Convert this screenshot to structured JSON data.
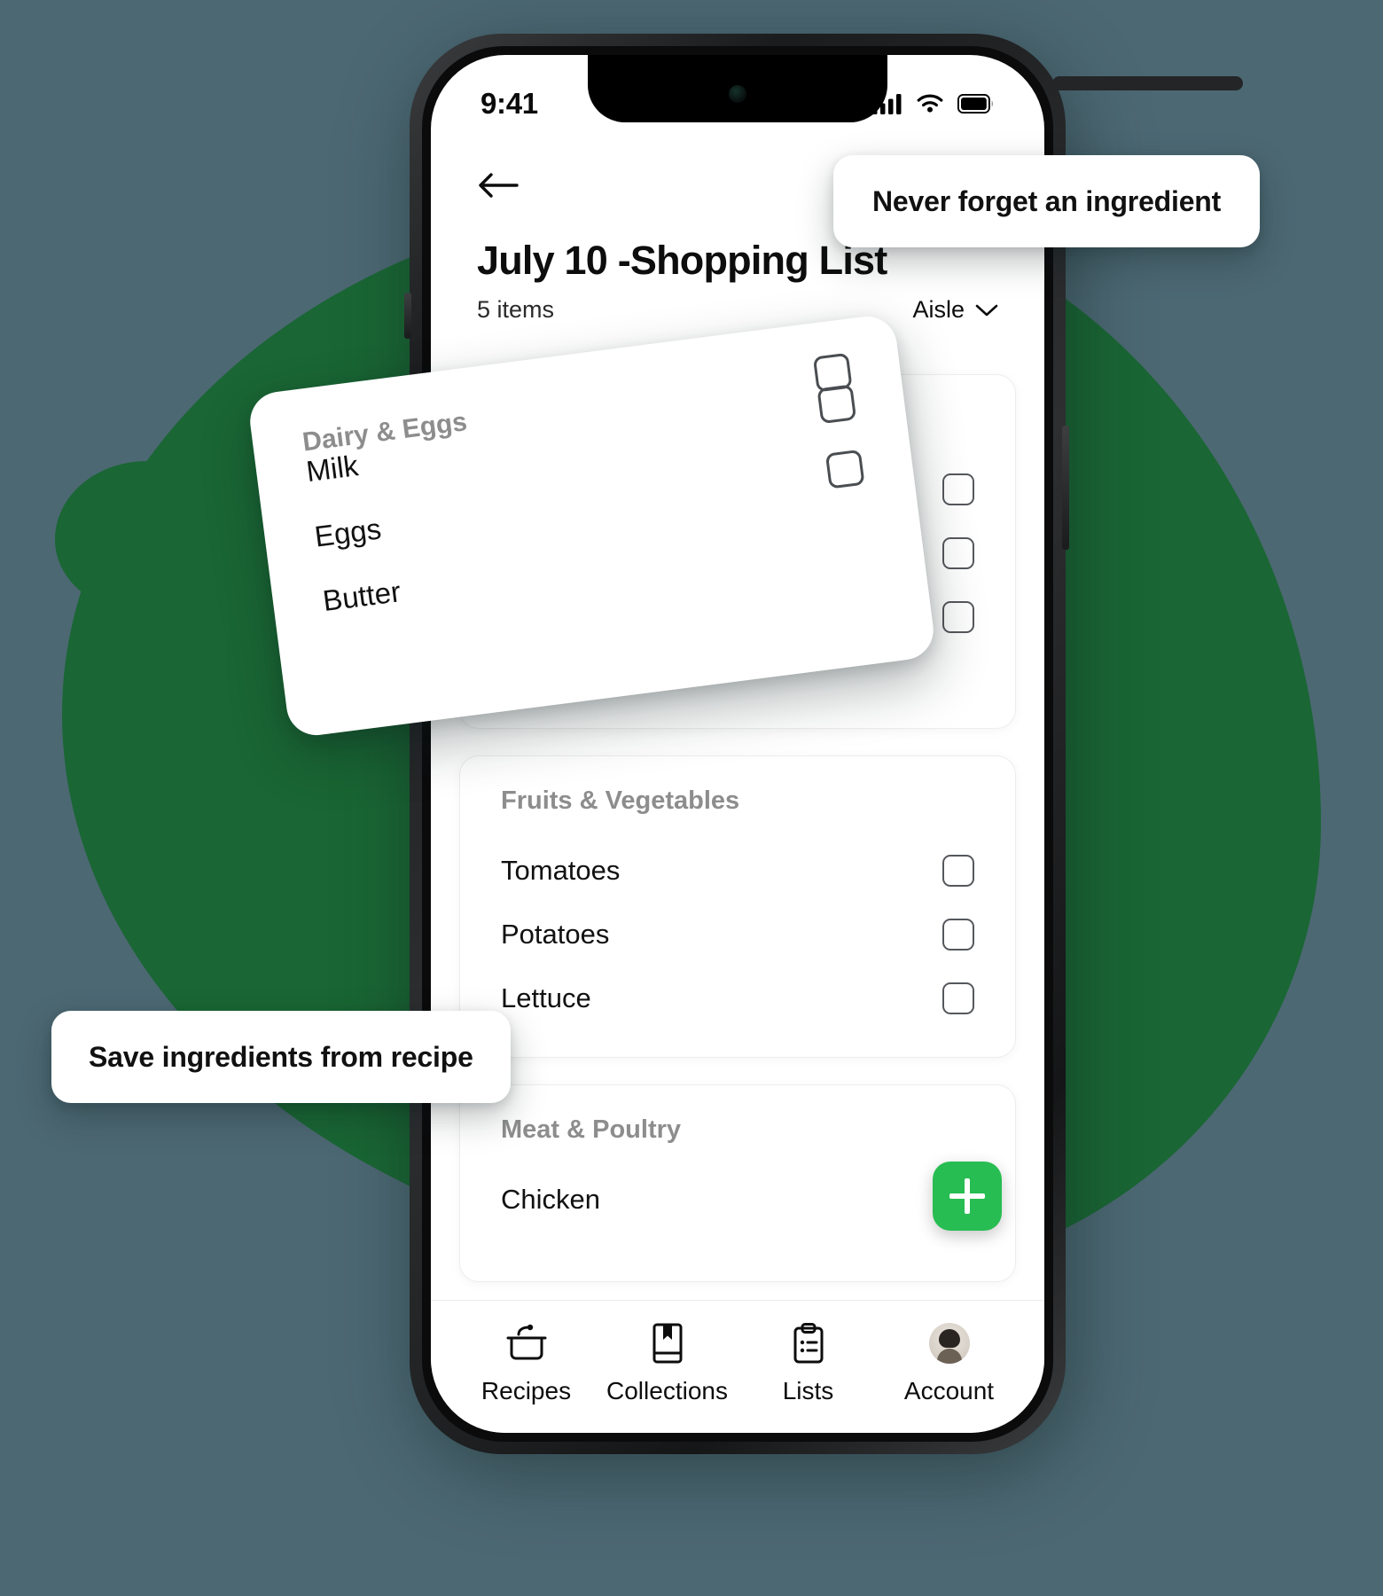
{
  "theme": {
    "background": "#4c6873",
    "blob_green": "#1a6634",
    "accent_green": "#27bd52",
    "card_white": "#ffffff",
    "muted_text": "#8d8d8d"
  },
  "callouts": [
    {
      "id": "never-forget",
      "text": "Never forget an ingredient"
    },
    {
      "id": "save-ingredients",
      "text": "Save ingredients from recipe"
    }
  ],
  "phone": {
    "status_bar": {
      "time": "9:41",
      "icons": [
        "signal-icon",
        "wifi-icon",
        "battery-icon"
      ]
    },
    "appbar": {
      "back_icon": "back-arrow-icon"
    },
    "header": {
      "title": "July 10 -Shopping List",
      "items_count": "5 items",
      "sort_label": "Aisle",
      "sort_icon": "chevron-down-icon"
    },
    "sections": [
      {
        "heading": "Dairy & Eggs",
        "items": [
          {
            "label": "Milk",
            "checked": false
          },
          {
            "label": "Eggs",
            "checked": false
          },
          {
            "label": "Butter",
            "checked": false
          }
        ]
      },
      {
        "heading": "Fruits & Vegetables",
        "items": [
          {
            "label": "Tomatoes",
            "checked": false
          },
          {
            "label": "Potatoes",
            "checked": false
          },
          {
            "label": "Lettuce",
            "checked": false
          }
        ]
      },
      {
        "heading": "Meat & Poultry",
        "items": [
          {
            "label": "Chicken",
            "checked": false
          }
        ]
      }
    ],
    "fab": {
      "icon": "plus-icon",
      "label": "Add item"
    },
    "tabbar": [
      {
        "label": "Recipes",
        "icon": "cooking-pot-icon",
        "active": false
      },
      {
        "label": "Collections",
        "icon": "bookmark-book-icon",
        "active": false
      },
      {
        "label": "Lists",
        "icon": "clipboard-list-icon",
        "active": true
      },
      {
        "label": "Account",
        "icon": "avatar-icon",
        "active": false
      }
    ]
  },
  "floating_card": {
    "heading": "Dairy & Eggs",
    "items": [
      {
        "label": "Milk",
        "checked": false
      },
      {
        "label": "Eggs",
        "checked": false
      },
      {
        "label": "Butter",
        "checked": false
      }
    ]
  }
}
